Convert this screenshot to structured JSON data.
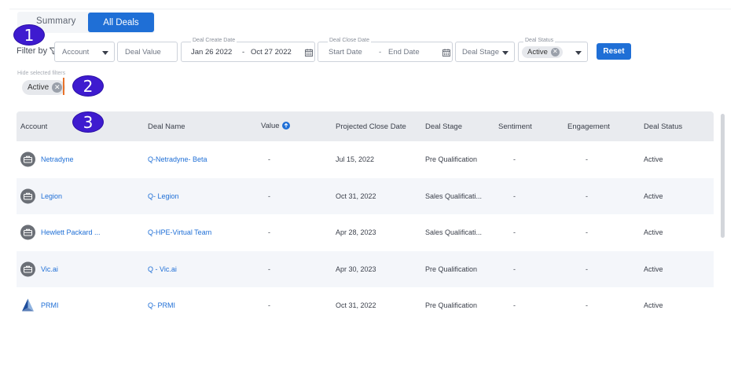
{
  "tabs": [
    {
      "label": "Summary",
      "active": false
    },
    {
      "label": "All Deals",
      "active": true
    }
  ],
  "annotations": [
    "1",
    "2",
    "3"
  ],
  "filters": {
    "filter_by_label": "Filter by",
    "account_placeholder": "Account",
    "deal_value_placeholder": "Deal Value",
    "deal_create_date": {
      "label": "Deal Create Date",
      "start": "Jan 26 2022",
      "separator": "-",
      "end": "Oct 27 2022"
    },
    "deal_close_date": {
      "label": "Deal Close Date",
      "start": "Start Date",
      "separator": "-",
      "end": "End Date"
    },
    "deal_stage_placeholder": "Deal Stage",
    "deal_status": {
      "label": "Deal Status",
      "chip": "Active"
    },
    "reset_label": "Reset",
    "hide_selected_label": "Hide selected filters",
    "selected_chip": "Active"
  },
  "table": {
    "columns": [
      "Account",
      "Deal Name",
      "Value",
      "Projected Close Date",
      "Deal Stage",
      "Sentiment",
      "Engagement",
      "Deal Status"
    ],
    "rows": [
      {
        "account": "Netradyne",
        "deal": "Q-Netradyne- Beta",
        "value": "-",
        "close": "Jul 15, 2022",
        "stage": "Pre Qualification",
        "sentiment": "-",
        "engagement": "-",
        "status": "Active",
        "icon": "briefcase-icon"
      },
      {
        "account": "Legion",
        "deal": "Q- Legion",
        "value": "-",
        "close": "Oct 31, 2022",
        "stage": "Sales Qualificati...",
        "sentiment": "-",
        "engagement": "-",
        "status": "Active",
        "icon": "briefcase-icon"
      },
      {
        "account": "Hewlett Packard ...",
        "deal": "Q-HPE-Virtual Team",
        "value": "-",
        "close": "Apr 28, 2023",
        "stage": "Sales Qualificati...",
        "sentiment": "-",
        "engagement": "-",
        "status": "Active",
        "icon": "briefcase-icon"
      },
      {
        "account": "Vic.ai",
        "deal": "Q - Vic.ai",
        "value": "-",
        "close": "Apr 30, 2023",
        "stage": "Pre Qualification",
        "sentiment": "-",
        "engagement": "-",
        "status": "Active",
        "icon": "briefcase-icon"
      },
      {
        "account": "PRMI",
        "deal": "Q- PRMI",
        "value": "-",
        "close": "Oct 31, 2022",
        "stage": "Pre Qualification",
        "sentiment": "-",
        "engagement": "-",
        "status": "Active",
        "icon": "prmi-logo-icon"
      }
    ]
  },
  "colors": {
    "accent": "#1f6fd6",
    "badge": "#3e1bcf",
    "highlight": "#e8722a"
  }
}
